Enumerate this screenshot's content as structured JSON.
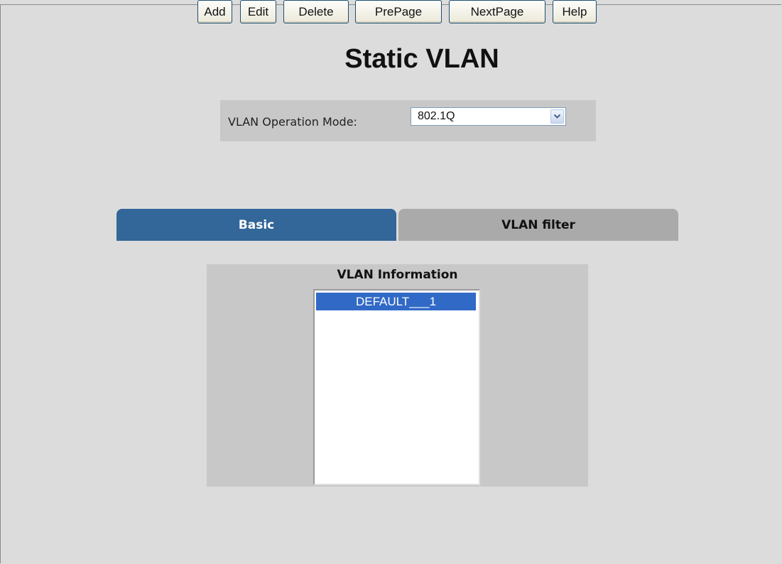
{
  "page": {
    "title": "Static VLAN"
  },
  "mode": {
    "label": "VLAN Operation Mode:",
    "value": "802.1Q"
  },
  "tabs": [
    {
      "label": "Basic",
      "active": true
    },
    {
      "label": "VLAN filter",
      "active": false
    }
  ],
  "vlan_info": {
    "title": "VLAN Information",
    "items": [
      "DEFAULT___1"
    ],
    "selected_index": 0
  },
  "buttons": {
    "add": "Add",
    "edit": "Edit",
    "delete": "Delete",
    "prepage": "PrePage",
    "nextpage": "NextPage",
    "help": "Help"
  },
  "colors": {
    "active_tab": "#336699",
    "inactive_tab": "#aaaaaa",
    "selection": "#3169c6",
    "background": "#dcdcdc",
    "panel": "#c8c8c8"
  }
}
